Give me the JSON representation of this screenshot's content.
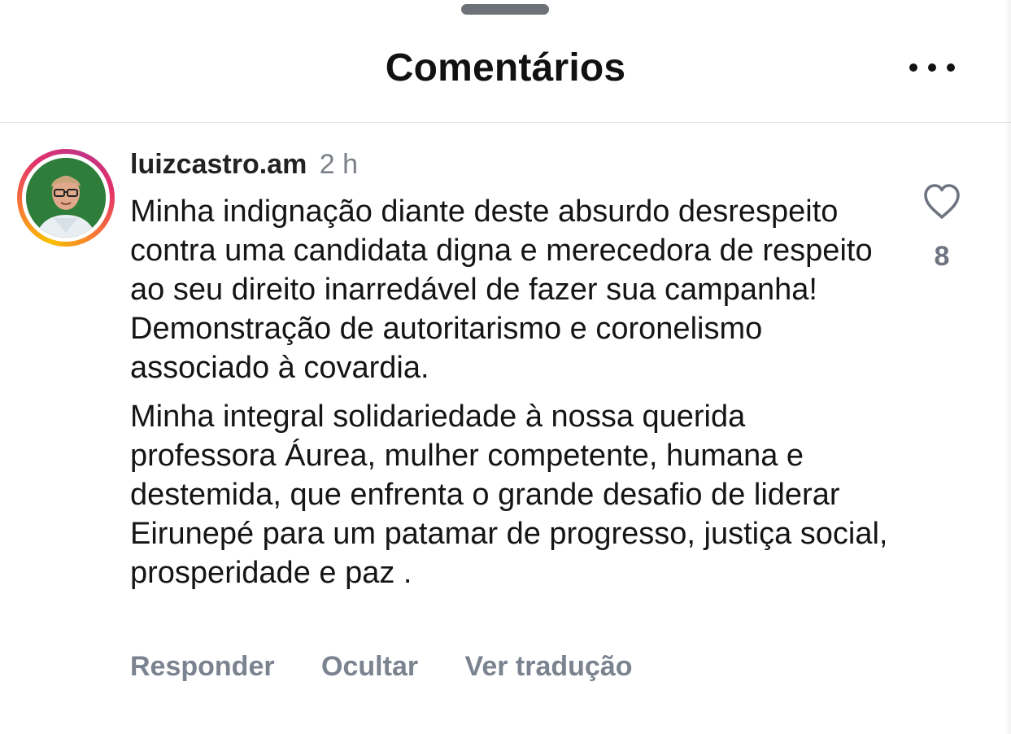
{
  "header": {
    "title": "Comentários",
    "more_icon": "ellipsis-icon"
  },
  "comment": {
    "username": "luizcastro.am",
    "time": "2 h",
    "paragraphs": [
      "Minha indignação diante deste absurdo desrespeito contra uma candidata digna e merecedora de respeito  ao seu direito inarredável de fazer sua campanha!\nDemonstração de autoritarismo e coronelismo associado à covardia.",
      " Minha integral solidariedade à nossa querida professora Áurea, mulher competente, humana e destemida, que enfrenta o grande desafio de liderar Eirunepé para um patamar  de progresso, justiça social, prosperidade e paz ."
    ],
    "like_icon": "heart-outline-icon",
    "like_count": "8",
    "actions": {
      "reply": "Responder",
      "hide": "Ocultar",
      "translate": "Ver tradução"
    }
  },
  "colors": {
    "text": "#151515",
    "secondary": "#7c8390",
    "story_ring_start": "#f9c000",
    "story_ring_end": "#c13584"
  }
}
